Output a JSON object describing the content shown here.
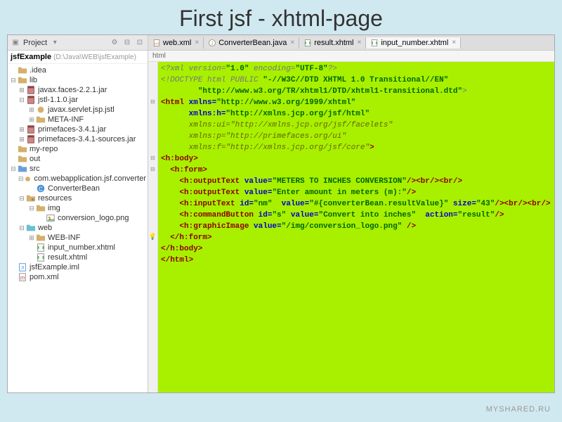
{
  "slide": {
    "title": "First jsf - xhtml-page"
  },
  "toolbar": {
    "project_label": "Project"
  },
  "tabs": [
    {
      "name": "web.xml",
      "icon": "xml"
    },
    {
      "name": "ConverterBean.java",
      "icon": "java"
    },
    {
      "name": "result.xhtml",
      "icon": "xhtml"
    },
    {
      "name": "input_number.xhtml",
      "icon": "xhtml",
      "active": true
    }
  ],
  "project": {
    "name": "jsfExample",
    "path": "(D:\\Java\\WEB\\jsfExample)"
  },
  "tree": [
    {
      "label": ".idea",
      "icon": "folder",
      "indent": 0,
      "toggle": ""
    },
    {
      "label": "lib",
      "icon": "folder",
      "indent": 0,
      "toggle": "−"
    },
    {
      "label": "javax.faces-2.2.1.jar",
      "icon": "jar",
      "indent": 1,
      "toggle": "+"
    },
    {
      "label": "jstl-1.1.0.jar",
      "icon": "jar",
      "indent": 1,
      "toggle": "−"
    },
    {
      "label": "javax.servlet.jsp.jstl",
      "icon": "pkg",
      "indent": 2,
      "toggle": "+"
    },
    {
      "label": "META-INF",
      "icon": "folder",
      "indent": 2,
      "toggle": "+"
    },
    {
      "label": "primefaces-3.4.1.jar",
      "icon": "jar",
      "indent": 1,
      "toggle": "+"
    },
    {
      "label": "primefaces-3.4.1-sources.jar",
      "icon": "jar",
      "indent": 1,
      "toggle": "+"
    },
    {
      "label": "my-repo",
      "icon": "folder",
      "indent": 0,
      "toggle": ""
    },
    {
      "label": "out",
      "icon": "folder",
      "indent": 0,
      "toggle": ""
    },
    {
      "label": "src",
      "icon": "folder-src",
      "indent": 0,
      "toggle": "−"
    },
    {
      "label": "com.webapplication.jsf.converter",
      "icon": "pkg",
      "indent": 1,
      "toggle": "−"
    },
    {
      "label": "ConverterBean",
      "icon": "class",
      "indent": 2,
      "toggle": ""
    },
    {
      "label": "resources",
      "icon": "folder-res",
      "indent": 1,
      "toggle": "−"
    },
    {
      "label": "img",
      "icon": "folder",
      "indent": 2,
      "toggle": "−"
    },
    {
      "label": "conversion_logo.png",
      "icon": "img",
      "indent": 3,
      "toggle": ""
    },
    {
      "label": "web",
      "icon": "folder-web",
      "indent": 1,
      "toggle": "−"
    },
    {
      "label": "WEB-INF",
      "icon": "folder",
      "indent": 2,
      "toggle": "+"
    },
    {
      "label": "input_number.xhtml",
      "icon": "xhtml",
      "indent": 2,
      "toggle": ""
    },
    {
      "label": "result.xhtml",
      "icon": "xhtml",
      "indent": 2,
      "toggle": ""
    },
    {
      "label": "jsfExample.iml",
      "icon": "iml",
      "indent": 0,
      "toggle": ""
    },
    {
      "label": "pom.xml",
      "icon": "maven",
      "indent": 0,
      "toggle": ""
    }
  ],
  "breadcrumb": "html",
  "code": [
    {
      "html": "<span class='c-gray'>&lt;?xml version=</span><span class='c-green'>\"1.0\"</span><span class='c-gray'> encoding=</span><span class='c-green'>\"UTF-8\"</span><span class='c-gray'>?&gt;</span>",
      "gutter": ""
    },
    {
      "html": "<span class='c-gray'>&lt;!DOCTYPE html PUBLIC </span><span class='c-green'>\"-//W3C//DTD XHTML 1.0 Transitional//EN\"</span>",
      "gutter": ""
    },
    {
      "html": "        <span class='c-green'>\"http://www.w3.org/TR/xhtml1/DTD/xhtml1-transitional.dtd\"</span><span class='c-gray'>&gt;</span>",
      "gutter": ""
    },
    {
      "html": "<span class='c-darkred'>&lt;html </span><span class='c-blue'>xmlns=</span><span class='c-green'>\"http://www.w3.org/1999/xhtml\"</span>",
      "gutter": "minus"
    },
    {
      "html": "      <span class='c-blue'>xmlns:h=</span><span class='c-green'>\"http://xmlns.jcp.org/jsf/html\"</span>",
      "gutter": ""
    },
    {
      "html": "      <span class='c-olive'>xmlns:ui=\"http://xmlns.jcp.org/jsf/facelets\"</span>",
      "gutter": ""
    },
    {
      "html": "      <span class='c-olive'>xmlns:p=\"http://primefaces.org/ui\"</span>",
      "gutter": ""
    },
    {
      "html": "      <span class='c-olive'>xmlns:f=\"http://xmlns.jcp.org/jsf/core\"</span><span class='c-darkred'>&gt;</span>",
      "gutter": ""
    },
    {
      "html": "<span class='c-darkred'>&lt;h:body&gt;</span>",
      "gutter": "minus"
    },
    {
      "html": "  <span class='c-darkred'>&lt;h:form&gt;</span>",
      "gutter": "minus"
    },
    {
      "html": "    <span class='c-darkred'>&lt;h:outputText </span><span class='c-blue'>value=</span><span class='c-green'>\"METERS TO INCHES CONVERSION\"</span><span class='c-darkred'>/&gt;&lt;br/&gt;&lt;br/&gt;</span>",
      "gutter": ""
    },
    {
      "html": "    <span class='c-darkred'>&lt;h:outputText </span><span class='c-blue'>value=</span><span class='c-green'>\"Enter amount in meters (m):\"</span><span class='c-darkred'>/&gt;</span>",
      "gutter": ""
    },
    {
      "html": "    <span class='c-darkred'>&lt;h:inputText </span><span class='c-blue'>id=</span><span class='c-green'>\"nm\"</span>  <span class='c-blue'>value=</span><span class='c-green'>\"#{converterBean.resultValue}\"</span> <span class='c-blue'>size=</span><span class='c-green'>\"43\"</span><span class='c-darkred'>/&gt;&lt;br/&gt;&lt;br/&gt;</span>",
      "gutter": ""
    },
    {
      "html": "    <span class='c-darkred'>&lt;h:commandButton </span><span class='c-blue'>id=</span><span class='c-green'>\"s\"</span> <span class='c-blue'>value=</span><span class='c-green'>\"Convert into inches\"</span>  <span class='c-blue'>action=</span><span class='c-green'>\"result\"</span><span class='c-darkred'>/&gt;</span>",
      "gutter": ""
    },
    {
      "html": "    <span class='c-darkred'>&lt;h:graphicImage </span><span class='c-blue'>value=</span><span class='c-green'>\"/img/conversion_logo.png\"</span><span class='c-darkred'> /&gt;</span>",
      "gutter": ""
    },
    {
      "html": "  <span class='c-darkred'>&lt;/h:form&gt;</span>",
      "gutter": "bulb"
    },
    {
      "html": "<span class='c-darkred'>&lt;/h:body&gt;</span>",
      "gutter": ""
    },
    {
      "html": "<span class='c-darkred'>&lt;/html&gt;</span>",
      "gutter": ""
    }
  ],
  "watermark": "MYSHARED.RU"
}
